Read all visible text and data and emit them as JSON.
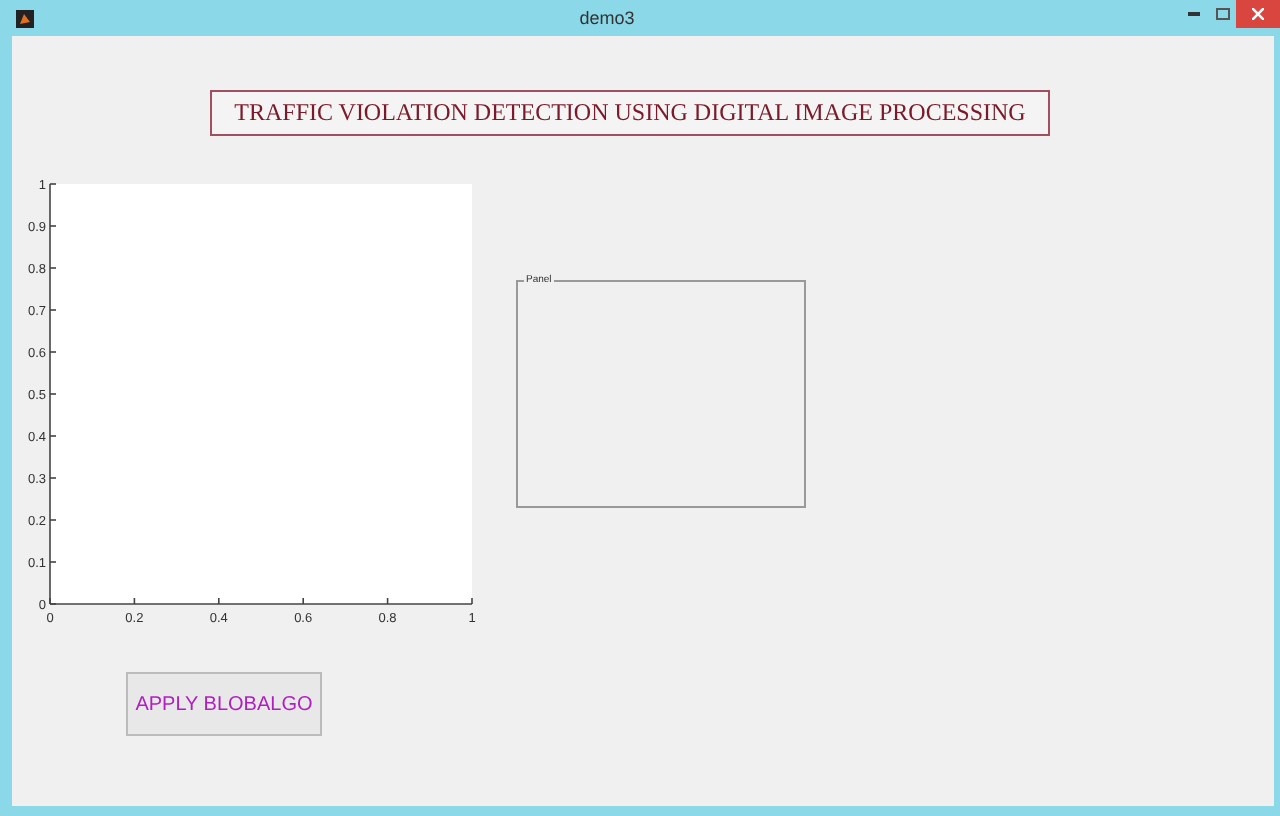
{
  "window": {
    "title": "demo3"
  },
  "heading": "TRAFFIC VIOLATION DETECTION USING DIGITAL IMAGE PROCESSING",
  "axes": {
    "chart_data": {
      "type": "line",
      "xlim": [
        0,
        1
      ],
      "ylim": [
        0,
        1
      ],
      "xticks": [
        0,
        0.2,
        0.4,
        0.6,
        {
          "value": 0.8,
          "label": "0.8"
        },
        1
      ],
      "yticks": [
        0,
        0.1,
        0.2,
        0.3,
        0.4,
        0.5,
        0.6,
        0.7,
        0.8,
        0.9,
        1
      ]
    }
  },
  "panel": {
    "title": "Panel"
  },
  "buttons": [
    "APPLY BLOBALGO"
  ]
}
